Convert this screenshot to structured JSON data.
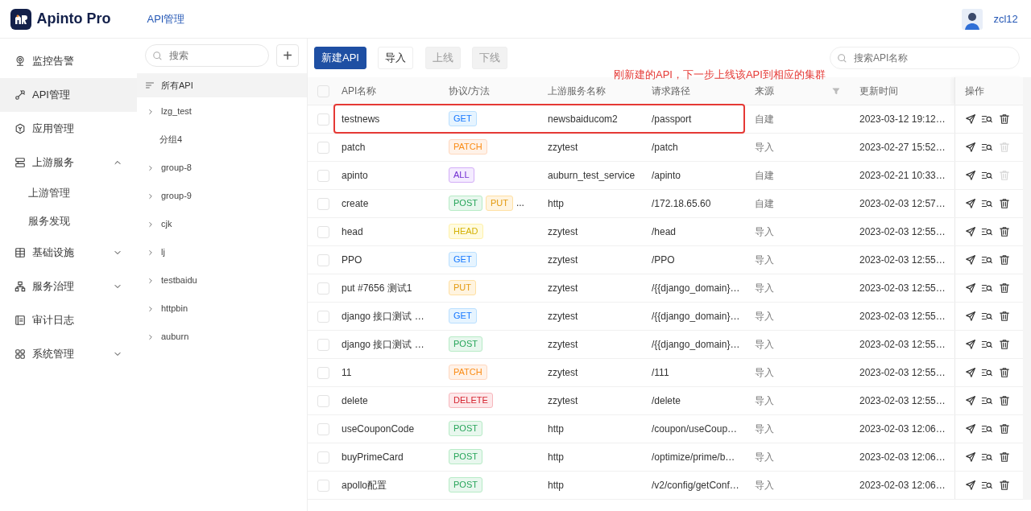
{
  "header": {
    "logo_text": "Apinto Pro",
    "breadcrumb": "API管理",
    "username": "zcl12"
  },
  "sidebar": {
    "items": [
      {
        "label": "监控告警",
        "kind": "monitor",
        "selected": false
      },
      {
        "label": "API管理",
        "kind": "api",
        "selected": true
      },
      {
        "label": "应用管理",
        "kind": "app",
        "selected": false
      },
      {
        "label": "上游服务",
        "kind": "upstream",
        "selected": false,
        "expanded": true,
        "children": [
          {
            "label": "上游管理",
            "selected": false
          },
          {
            "label": "服务发现",
            "selected": false
          }
        ]
      },
      {
        "label": "基础设施",
        "kind": "infra",
        "selected": false,
        "expanded": false
      },
      {
        "label": "服务治理",
        "kind": "govern",
        "selected": false,
        "expanded": false
      },
      {
        "label": "审计日志",
        "kind": "audit",
        "selected": false
      },
      {
        "label": "系统管理",
        "kind": "system",
        "selected": false,
        "expanded": false
      }
    ]
  },
  "groups": {
    "search": {
      "placeholder": "搜索"
    },
    "add_label": "+",
    "all": {
      "label": "所有API",
      "selected": true
    },
    "items": [
      {
        "label": "lzg_test",
        "expandable": true
      },
      {
        "label": "分组4",
        "expandable": false
      },
      {
        "label": "group-8",
        "expandable": true
      },
      {
        "label": "group-9",
        "expandable": true
      },
      {
        "label": "cjk",
        "expandable": true
      },
      {
        "label": "lj",
        "expandable": true
      },
      {
        "label": "testbaidu",
        "expandable": true
      },
      {
        "label": "httpbin",
        "expandable": true
      },
      {
        "label": "auburn",
        "expandable": true
      }
    ]
  },
  "toolbar": {
    "buttons": [
      {
        "label": "新建API",
        "kind": "primary",
        "disabled": false
      },
      {
        "label": "导入",
        "kind": "default",
        "disabled": false
      },
      {
        "label": "上线",
        "kind": "default",
        "disabled": true
      },
      {
        "label": "下线",
        "kind": "default",
        "disabled": true
      }
    ],
    "search": {
      "placeholder": "搜索API名称"
    }
  },
  "annotation": {
    "text": "刚新建的API，下一步上线该API到相应的集群"
  },
  "table": {
    "select_all": false,
    "columns": [
      "API名称",
      "协议/方法",
      "上游服务名称",
      "请求路径",
      "来源",
      "更新时间",
      "操作"
    ],
    "rows": [
      {
        "checked": false,
        "highlighted": true,
        "name": "testnews",
        "methods": [
          "GET"
        ],
        "upstream": "newsbaiducom2",
        "path": "/passport",
        "source": "自建",
        "updated": "2023-03-12 19:12…",
        "delete_disabled": false
      },
      {
        "checked": false,
        "name": "patch",
        "methods": [
          "PATCH"
        ],
        "upstream": "zzytest",
        "path": "/patch",
        "source": "导入",
        "updated": "2023-02-27 15:52…",
        "delete_disabled": true
      },
      {
        "checked": false,
        "name": "apinto",
        "methods": [
          "ALL"
        ],
        "upstream": "auburn_test_service",
        "path": "/apinto",
        "source": "自建",
        "updated": "2023-02-21 10:33…",
        "delete_disabled": true
      },
      {
        "checked": false,
        "name": "create",
        "methods": [
          "POST",
          "PUT"
        ],
        "more": "...",
        "upstream": "http",
        "path": "/172.18.65.60",
        "source": "自建",
        "updated": "2023-02-03 12:57…",
        "delete_disabled": false
      },
      {
        "checked": false,
        "name": "head",
        "methods": [
          "HEAD"
        ],
        "upstream": "zzytest",
        "path": "/head",
        "source": "导入",
        "updated": "2023-02-03 12:55…",
        "delete_disabled": false
      },
      {
        "checked": false,
        "name": "PPO",
        "methods": [
          "GET"
        ],
        "upstream": "zzytest",
        "path": "/PPO",
        "source": "导入",
        "updated": "2023-02-03 12:55…",
        "delete_disabled": false
      },
      {
        "checked": false,
        "name": "put #7656 测试1",
        "methods": [
          "PUT"
        ],
        "upstream": "zzytest",
        "path": "/{{django_domain}…",
        "source": "导入",
        "updated": "2023-02-03 12:55…",
        "delete_disabled": false
      },
      {
        "checked": false,
        "name": "django 接口测试 …",
        "methods": [
          "GET"
        ],
        "upstream": "zzytest",
        "path": "/{{django_domain}…",
        "source": "导入",
        "updated": "2023-02-03 12:55…",
        "delete_disabled": false
      },
      {
        "checked": false,
        "name": "django 接口测试 …",
        "methods": [
          "POST"
        ],
        "upstream": "zzytest",
        "path": "/{{django_domain}…",
        "source": "导入",
        "updated": "2023-02-03 12:55…",
        "delete_disabled": false
      },
      {
        "checked": false,
        "name": "11",
        "methods": [
          "PATCH"
        ],
        "upstream": "zzytest",
        "path": "/111",
        "source": "导入",
        "updated": "2023-02-03 12:55…",
        "delete_disabled": false
      },
      {
        "checked": false,
        "name": "delete",
        "methods": [
          "DELETE"
        ],
        "upstream": "zzytest",
        "path": "/delete",
        "source": "导入",
        "updated": "2023-02-03 12:55…",
        "delete_disabled": false
      },
      {
        "checked": false,
        "name": "useCouponCode",
        "methods": [
          "POST"
        ],
        "upstream": "http",
        "path": "/coupon/useCoup…",
        "source": "导入",
        "updated": "2023-02-03 12:06…",
        "delete_disabled": false
      },
      {
        "checked": false,
        "name": "buyPrimeCard",
        "methods": [
          "POST"
        ],
        "upstream": "http",
        "path": "/optimize/prime/b…",
        "source": "导入",
        "updated": "2023-02-03 12:06…",
        "delete_disabled": false
      },
      {
        "checked": false,
        "name": "apollo配置",
        "methods": [
          "POST"
        ],
        "upstream": "http",
        "path": "/v2/config/getConf…",
        "source": "导入",
        "updated": "2023-02-03 12:06…",
        "delete_disabled": false
      }
    ]
  }
}
